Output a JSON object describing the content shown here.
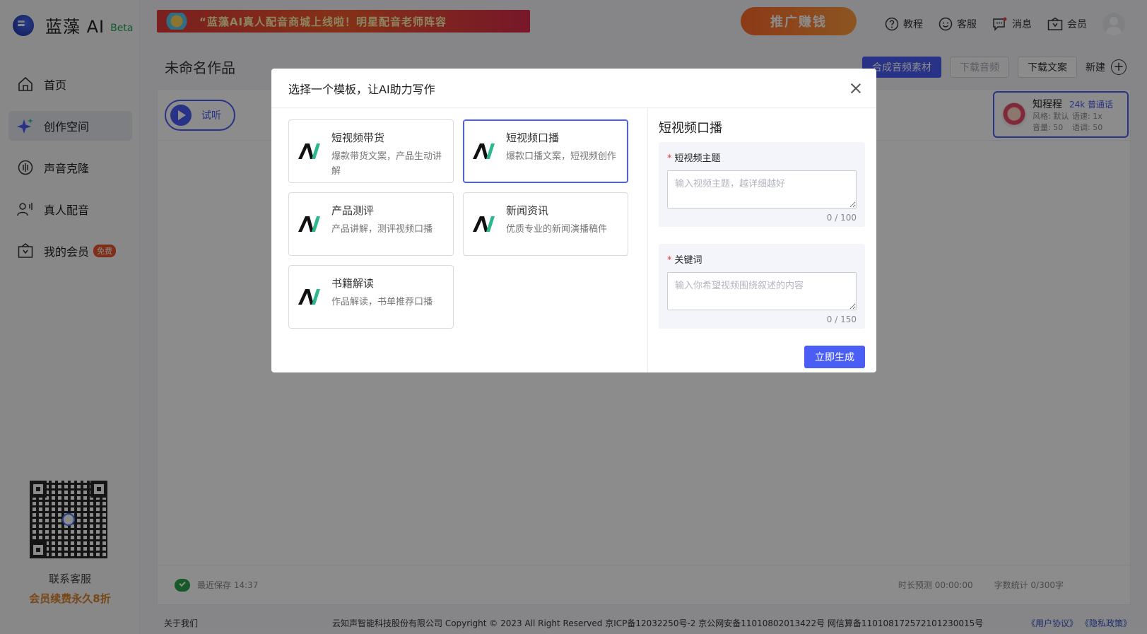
{
  "app": {
    "name": "蓝藻 AI",
    "beta": "Beta"
  },
  "banner": {
    "text": "“蓝藻AI真人配音商城上线啦！明星配音老师阵容"
  },
  "promo": {
    "text": "推广赚钱"
  },
  "topnav": [
    {
      "icon": "help-icon",
      "label": "教程"
    },
    {
      "icon": "service-icon",
      "label": "客服"
    },
    {
      "icon": "message-icon",
      "label": "消息"
    },
    {
      "icon": "vip-icon",
      "label": "会员"
    }
  ],
  "sidebar": {
    "items": [
      {
        "icon": "home-icon",
        "label": "首页"
      },
      {
        "icon": "sparkle-icon",
        "label": "创作空间",
        "active": true
      },
      {
        "icon": "voice-clone-icon",
        "label": "声音克隆"
      },
      {
        "icon": "human-voice-icon",
        "label": "真人配音"
      },
      {
        "icon": "membership-icon",
        "label": "我的会员",
        "badge": "免费"
      }
    ],
    "contact": "联系客服",
    "promo": "会员续费永久8折"
  },
  "page": {
    "title": "未命名作品"
  },
  "actions": {
    "synthesize": "合成音频素材",
    "download_audio": "下载音频",
    "download_text": "下载文案",
    "new": "新建"
  },
  "editor": {
    "listen": "试听",
    "voice": {
      "name": "知程程",
      "tag": "24k 普通话",
      "style": "风格: 默认",
      "speed": "语速: 1x",
      "volume": "音量: 50",
      "pitch": "语调: 50"
    },
    "footer": {
      "saved": "最近保存 14:37",
      "duration": "时长预测 00:00:00",
      "words": "字数统计 0/300字"
    }
  },
  "footer": {
    "about": "关于我们",
    "copyright": "云知声智能科技股份有限公司 Copyright © 2023 All Right Reserved 京ICP备12032250号-2 京公网安备11010802013422号 网信算备110108172572101230015号",
    "user_agreement": "《用户协议》",
    "privacy": "《隐私政策》"
  },
  "modal": {
    "title": "选择一个模板，让AI助力写作",
    "templates": [
      {
        "title": "短视频带货",
        "desc": "爆款带货文案，产品生动讲解"
      },
      {
        "title": "短视频口播",
        "desc": "爆款口播文案，短视频创作",
        "selected": true
      },
      {
        "title": "产品测评",
        "desc": "产品讲解，测评视频口播"
      },
      {
        "title": "新闻资讯",
        "desc": "优质专业的新闻演播稿件"
      },
      {
        "title": "书籍解读",
        "desc": "作品解读，书单推荐口播"
      }
    ],
    "form": {
      "title": "短视频口播",
      "topic": {
        "label": "短视频主题",
        "placeholder": "输入视频主题，越详细越好",
        "count": "0 / 100"
      },
      "keywords": {
        "label": "关键词",
        "placeholder": "输入你希望视频围绕叙述的内容",
        "count": "0 / 150"
      },
      "submit": "立即生成"
    }
  },
  "colors": {
    "accent": "#4a5ef6",
    "success": "#2aa24a",
    "badge": "#e8542c"
  }
}
